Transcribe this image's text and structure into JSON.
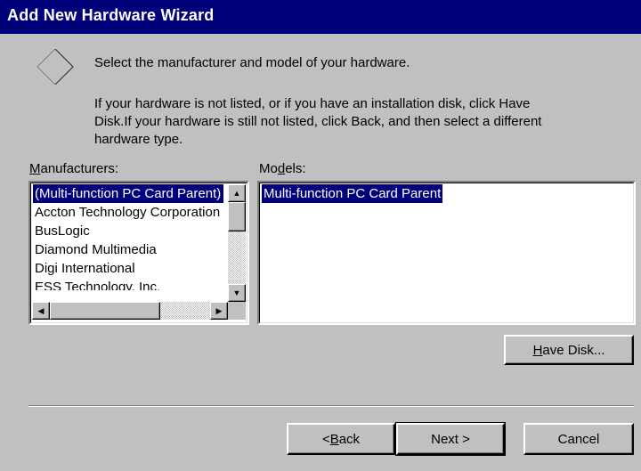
{
  "window": {
    "title": "Add New Hardware Wizard"
  },
  "intro": {
    "line1": "Select the manufacturer and model of your hardware.",
    "line2a": "If your hardware is not listed, or if you have an installation disk, click Have",
    "line2b": "Disk.If your hardware is still not listed, click Back, and then select a different",
    "line2c": "hardware type."
  },
  "manufacturers": {
    "label_u": "M",
    "label_rest": "anufacturers:",
    "items": [
      "(Multi-function PC Card Parent)",
      "Accton Technology Corporation",
      "BusLogic",
      "Diamond Multimedia",
      "Digi International",
      "ESS Technology, Inc."
    ],
    "selected_index": 0
  },
  "models": {
    "label_a": "Mo",
    "label_u": "d",
    "label_b": "els:",
    "items": [
      "Multi-function PC Card Parent"
    ],
    "selected_index": 0
  },
  "buttons": {
    "have_disk_u": "H",
    "have_disk_rest": "ave Disk...",
    "back_pre": "< ",
    "back_u": "B",
    "back_rest": "ack",
    "next": "Next >",
    "cancel": "Cancel"
  },
  "icons": {
    "wizard": "diamond-icon",
    "scroll_up": "up-arrow-icon",
    "scroll_down": "down-arrow-icon",
    "scroll_left": "left-arrow-icon",
    "scroll_right": "right-arrow-icon"
  },
  "colors": {
    "titlebar": "#00007b",
    "selection": "#00007b",
    "face": "#c0c0c0"
  }
}
